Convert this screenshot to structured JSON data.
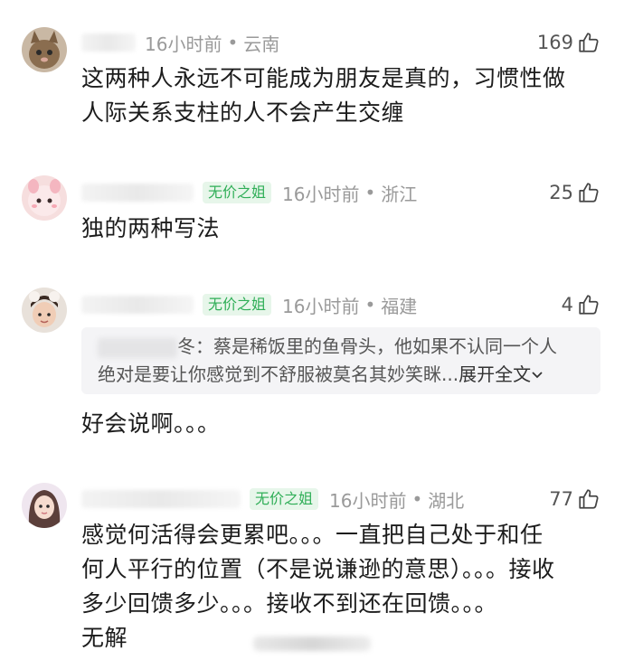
{
  "comments": [
    {
      "time": "16小时前",
      "location": "云南",
      "likes": "169",
      "text_lines": [
        "这两种人永远不可能成为朋友是真的，习惯性做",
        "人际关系支柱的人不会产生交缠"
      ]
    },
    {
      "badge": "无价之姐",
      "time": "16小时前",
      "location": "浙江",
      "likes": "25",
      "text_lines": [
        "独的两种写法"
      ]
    },
    {
      "badge": "无价之姐",
      "time": "16小时前",
      "location": "福建",
      "likes": "4",
      "quote_line1": "冬：蔡是稀饭里的鱼骨头，他如果不认同一个人",
      "quote_line2": "绝对是要让你感觉到不舒服被莫名其妙笑眯...",
      "quote_expand": "展开全文",
      "text_lines": [
        "好会说啊。。。"
      ]
    },
    {
      "badge": "无价之姐",
      "time": "16小时前",
      "location": "湖北",
      "likes": "77",
      "text_lines": [
        "感觉何活得会更累吧。。。一直把自己处于和任",
        "何人平行的位置（不是说谦逊的意思）。。。接收",
        "多少回馈多少。。。接收不到还在回馈。。。",
        "无解"
      ]
    }
  ],
  "colors": {
    "badge_text": "#2fae57",
    "badge_bg": "#e7f6ea",
    "meta": "#9a9a9a"
  }
}
